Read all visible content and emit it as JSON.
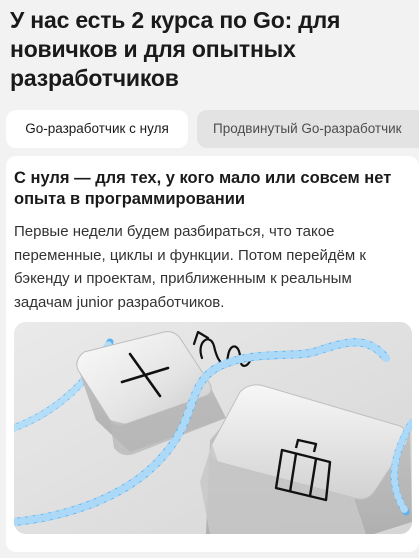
{
  "page": {
    "heading": "У нас есть 2 курса по Go: для новичков и для опытных разработчиков"
  },
  "tabs": [
    {
      "label": "Go-разработчик с нуля",
      "active": true
    },
    {
      "label": "Продвинутый Go-разработчик",
      "active": false
    }
  ],
  "course_card": {
    "title": "С нуля — для тех, у кого мало или совсем нет опыта в программировании",
    "description": "Первые недели будем разбираться, что такое переменные, циклы и функции. Потом перейдём к бэкенду и проектам, приближенным к реальным задачам junior разработчиков.",
    "illustration": {
      "icons": [
        "cross-icon",
        "squiggle-arrow-icon",
        "briefcase-icon"
      ],
      "cable_color": "#5ab3f0"
    }
  },
  "colors": {
    "background": "#f2f2f2",
    "card": "#ffffff",
    "inactive_tab": "#e3e3e3",
    "text": "#1a1a1a"
  }
}
